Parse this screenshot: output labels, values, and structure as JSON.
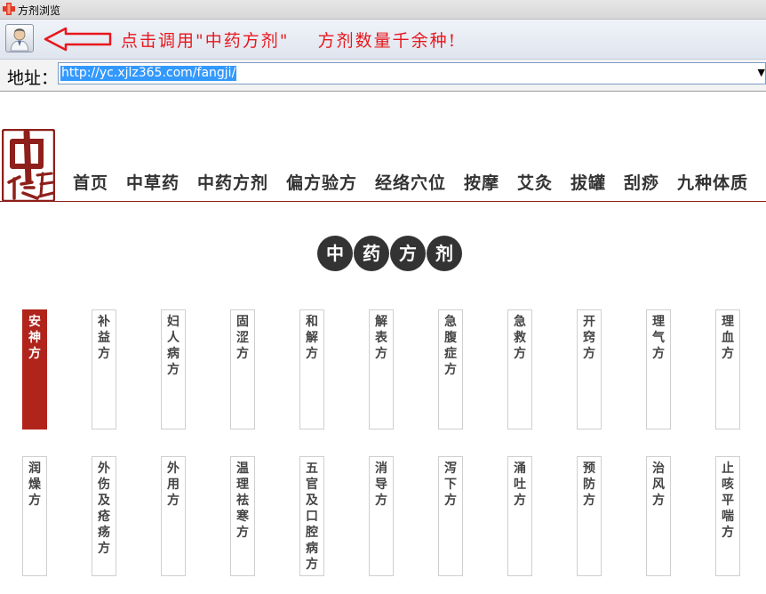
{
  "window": {
    "title": "方剂浏览"
  },
  "toolbar": {
    "hint": "点击调用\"中药方剂\"    方剂数量千余种!"
  },
  "address": {
    "label": "地址：",
    "url": "http://yc.xjlz365.com/fangji/"
  },
  "site": {
    "nav": [
      "首页",
      "中草药",
      "中药方剂",
      "偏方验方",
      "经络穴位",
      "按摩",
      "艾灸",
      "拔罐",
      "刮痧",
      "九种体质"
    ],
    "heading": [
      "中",
      "药",
      "方",
      "剂"
    ]
  },
  "categories_row1": [
    "安神方",
    "补益方",
    "妇人病方",
    "固涩方",
    "和解方",
    "解表方",
    "急腹症方",
    "急救方",
    "开窍方",
    "理气方",
    "理血方"
  ],
  "categories_row2": [
    "润燥方",
    "外伤及疮疡方",
    "外用方",
    "温理祛寒方",
    "五官及口腔病方",
    "消导方",
    "泻下方",
    "涌吐方",
    "预防方",
    "治风方",
    "止咳平喘方"
  ],
  "colors": {
    "accent": "#b0241b",
    "hint_red": "#e8171d",
    "heading_circle": "#333333"
  },
  "icons": {
    "app": "medical-cross-icon",
    "avatar": "doctor-avatar-icon",
    "arrow": "left-arrow-icon",
    "dropdown": "dropdown-arrow-icon",
    "logo": "zhongyi-guan-logo"
  }
}
